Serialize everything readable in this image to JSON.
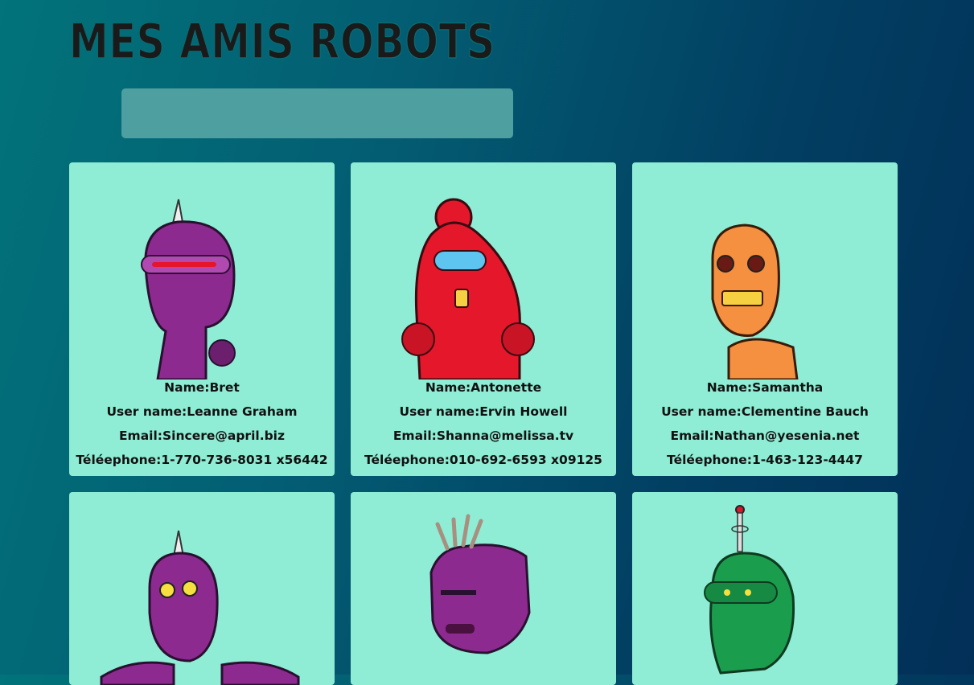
{
  "app": {
    "title": "MES AMIS ROBOTS"
  },
  "search": {
    "placeholder": "",
    "value": ""
  },
  "cards": [
    {
      "name": "Bret",
      "username": "Leanne Graham",
      "email": "Sincere@april.biz",
      "phone": "1-770-736-8031 x56442",
      "robot_color": "#8d2a8f"
    },
    {
      "name": "Antonette",
      "username": "Ervin Howell",
      "email": "Shanna@melissa.tv",
      "phone": "010-692-6593 x09125",
      "robot_color": "#e5172b"
    },
    {
      "name": "Samantha",
      "username": "Clementine Bauch",
      "email": "Nathan@yesenia.net",
      "phone": "1-463-123-4447",
      "robot_color": "#f4903f"
    },
    {
      "robot_color": "#8d2a8f"
    },
    {
      "robot_color": "#8d2a8f"
    },
    {
      "robot_color": "#1a9e4e"
    }
  ],
  "labels": {
    "name": "Name:",
    "username": "User name:",
    "email": "Email:",
    "phone": "Téléephone:"
  }
}
